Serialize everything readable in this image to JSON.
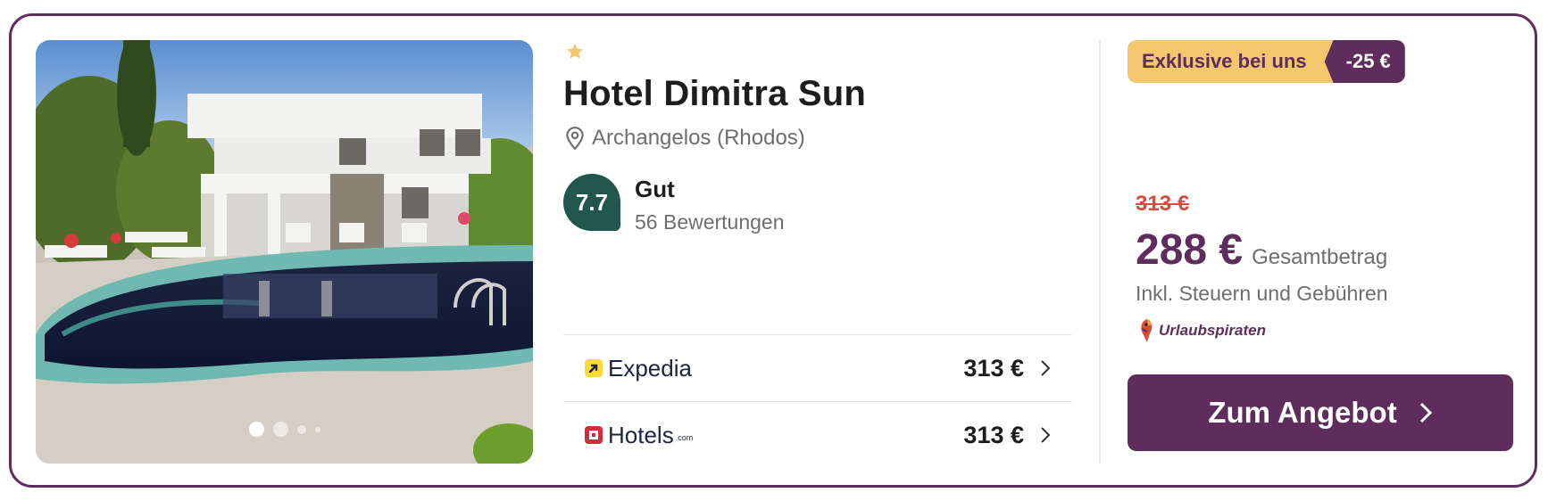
{
  "hotel": {
    "stars": 1,
    "name": "Hotel Dimitra Sun",
    "location": "Archangelos (Rhodos)",
    "rating": {
      "score": "7.7",
      "word": "Gut",
      "count": "56 Bewertungen",
      "color": "#21574b"
    }
  },
  "gallery": {
    "image": "hotel-pool-photo",
    "slides": 4,
    "active_slide": 1
  },
  "offers": [
    {
      "provider": "Expedia",
      "icon": "expedia-logo-icon",
      "price": "313 €"
    },
    {
      "provider": "Hotels",
      "provider_suffix": ".com",
      "icon": "hotels-com-logo-icon",
      "price": "313 €"
    }
  ],
  "deal": {
    "badge_label": "Exklusive bei uns",
    "badge_discount": "-25 €",
    "old_price": "313 €",
    "price": "288 €",
    "price_label": "Gesamtbetrag",
    "tax_note": "Inkl. Steuern und Gebühren",
    "partner": "Urlaubspiraten",
    "cta_label": "Zum Angebot"
  },
  "colors": {
    "brand": "#5e2d5c",
    "badge": "#f4c76d",
    "old_price": "#d94b3b",
    "star": "#f4c76d"
  }
}
